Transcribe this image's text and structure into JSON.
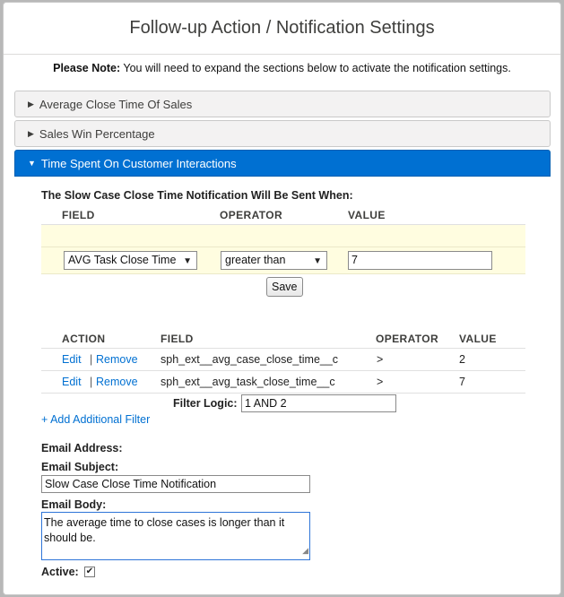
{
  "modal": {
    "title": "Follow-up Action / Notification Settings"
  },
  "note": {
    "bold": "Please Note:",
    "text": " You will need to expand the sections below to activate the notification settings."
  },
  "sections": [
    {
      "label": "Average Close Time Of Sales",
      "expanded": false
    },
    {
      "label": "Sales Win Percentage",
      "expanded": false
    },
    {
      "label": "Time Spent On Customer Interactions",
      "expanded": true
    }
  ],
  "condition": {
    "title": "The Slow Case Close Time Notification Will Be Sent When:",
    "headers": {
      "field": "FIELD",
      "operator": "OPERATOR",
      "value": "VALUE"
    },
    "field_select": "AVG Task Close Time",
    "operator_select": "greater than",
    "value_input": "7",
    "save_label": "Save"
  },
  "filters": {
    "headers": {
      "action": "ACTION",
      "field": "FIELD",
      "operator": "OPERATOR",
      "value": "VALUE"
    },
    "rows": [
      {
        "edit": "Edit",
        "sep": "|",
        "remove": "Remove",
        "field": "sph_ext__avg_case_close_time__c",
        "operator": ">",
        "value": "2"
      },
      {
        "edit": "Edit",
        "sep": "|",
        "remove": "Remove",
        "field": "sph_ext__avg_task_close_time__c",
        "operator": ">",
        "value": "7"
      }
    ],
    "logic_label": "Filter Logic:",
    "logic_value": "1 AND 2",
    "add_label": "+ Add Additional Filter"
  },
  "email": {
    "address_label": "Email Address:",
    "subject_label": "Email Subject:",
    "subject_value": "Slow Case Close Time Notification",
    "body_label": "Email Body:",
    "body_value": "The average time to close cases is longer than it should be.",
    "active_label": "Active:",
    "active_checked": true
  },
  "icons": {
    "collapsed": "triangle-right-icon",
    "expanded": "triangle-down-icon",
    "dropdown": "chevron-down-icon",
    "check": "checkmark-icon"
  }
}
